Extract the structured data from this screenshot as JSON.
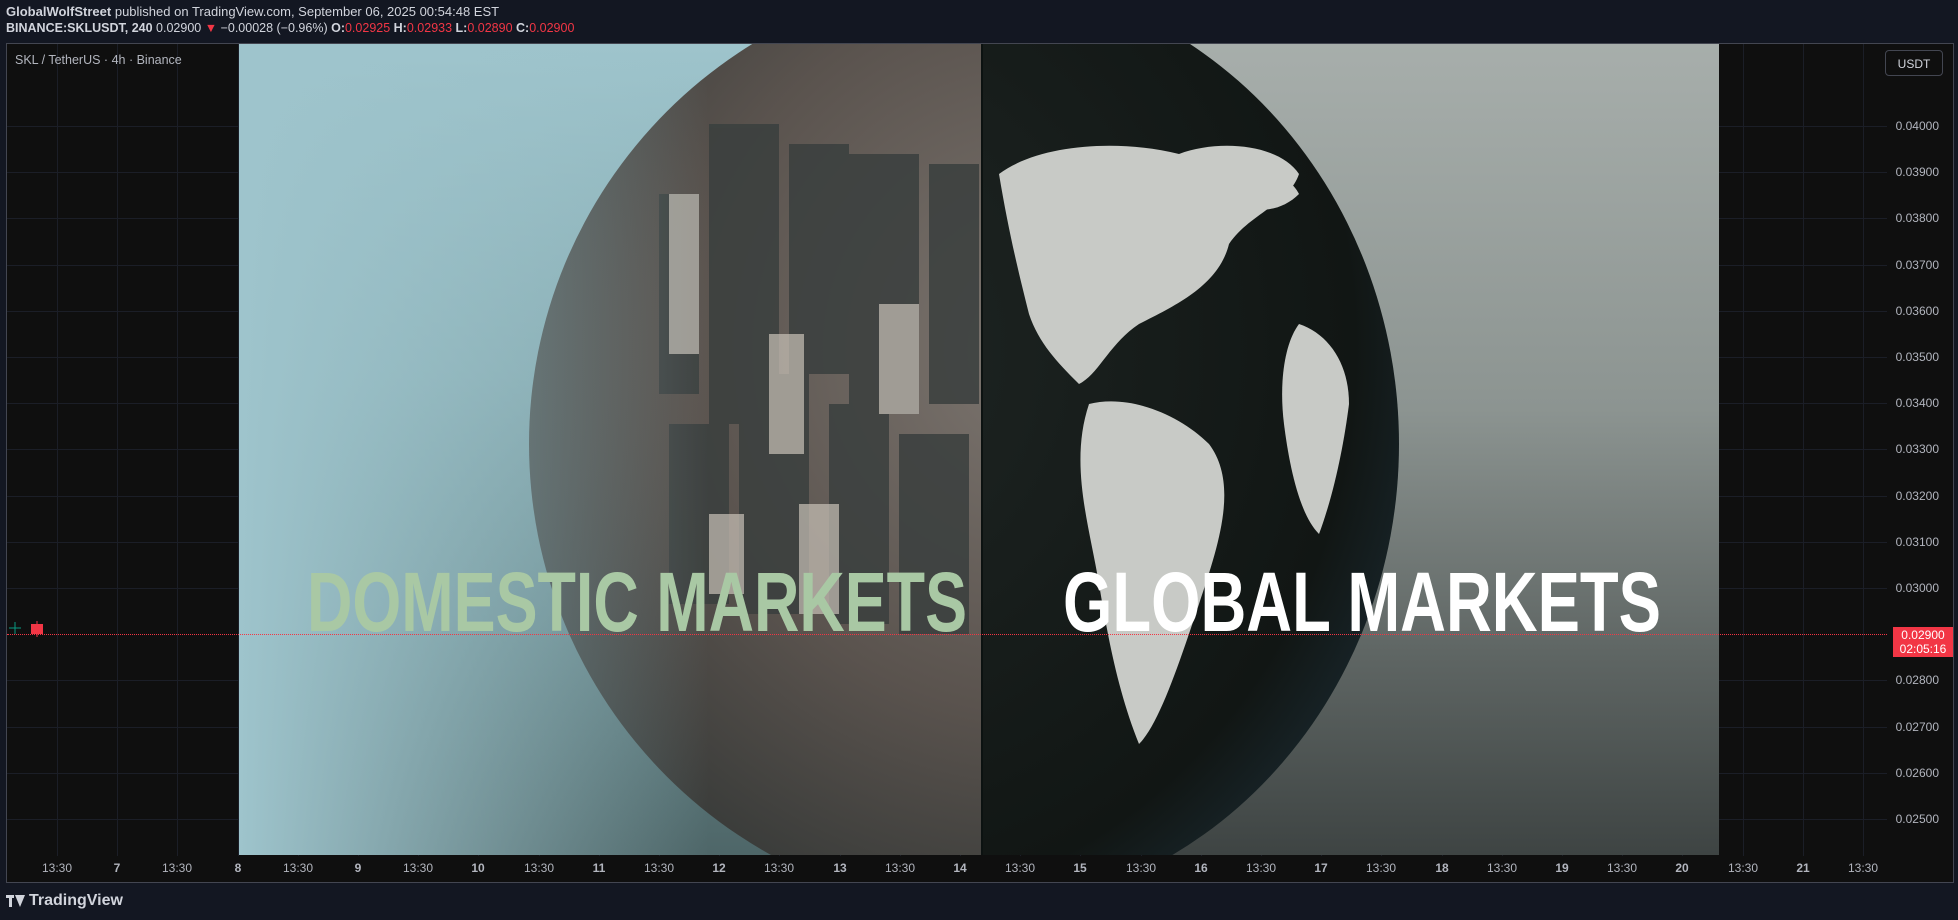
{
  "header": {
    "author": "GlobalWolfStreet",
    "published_text": "published on TradingView.com, September 06, 2025 00:54:48 EST",
    "symbol": "BINANCE:SKLUSDT, 240",
    "last": "0.02900",
    "change": "−0.00028 (−0.96%)",
    "o_label": "O:",
    "o": "0.02925",
    "h_label": "H:",
    "h": "0.02933",
    "l_label": "L:",
    "l": "0.02890",
    "c_label": "C:",
    "c": "0.02900"
  },
  "legend": "SKL / TetherUS · 4h · Binance",
  "currency_button": "USDT",
  "y_axis": [
    "0.04000",
    "0.03900",
    "0.03800",
    "0.03700",
    "0.03600",
    "0.03500",
    "0.03400",
    "0.03300",
    "0.03200",
    "0.03100",
    "0.03000",
    "0.02800",
    "0.02700",
    "0.02600",
    "0.02500"
  ],
  "x_axis": [
    "13:30",
    "7",
    "13:30",
    "8",
    "13:30",
    "9",
    "13:30",
    "10",
    "13:30",
    "11",
    "13:30",
    "12",
    "13:30",
    "13",
    "13:30",
    "14",
    "13:30",
    "15",
    "13:30",
    "16",
    "13:30",
    "17",
    "13:30",
    "18",
    "13:30",
    "19",
    "13:30",
    "20",
    "13:30",
    "21",
    "13:30"
  ],
  "price_tag": {
    "price": "0.02900",
    "countdown": "02:05:16"
  },
  "artwork": {
    "left_title": "DOMESTIC MARKETS",
    "right_title": "GLOBAL MARKETS"
  },
  "footer": {
    "brand": "TradingView"
  },
  "colors": {
    "down": "#f23645",
    "background": "#0f0f0f",
    "left_title": "#a9c8a4",
    "right_title": "#ffffff"
  }
}
